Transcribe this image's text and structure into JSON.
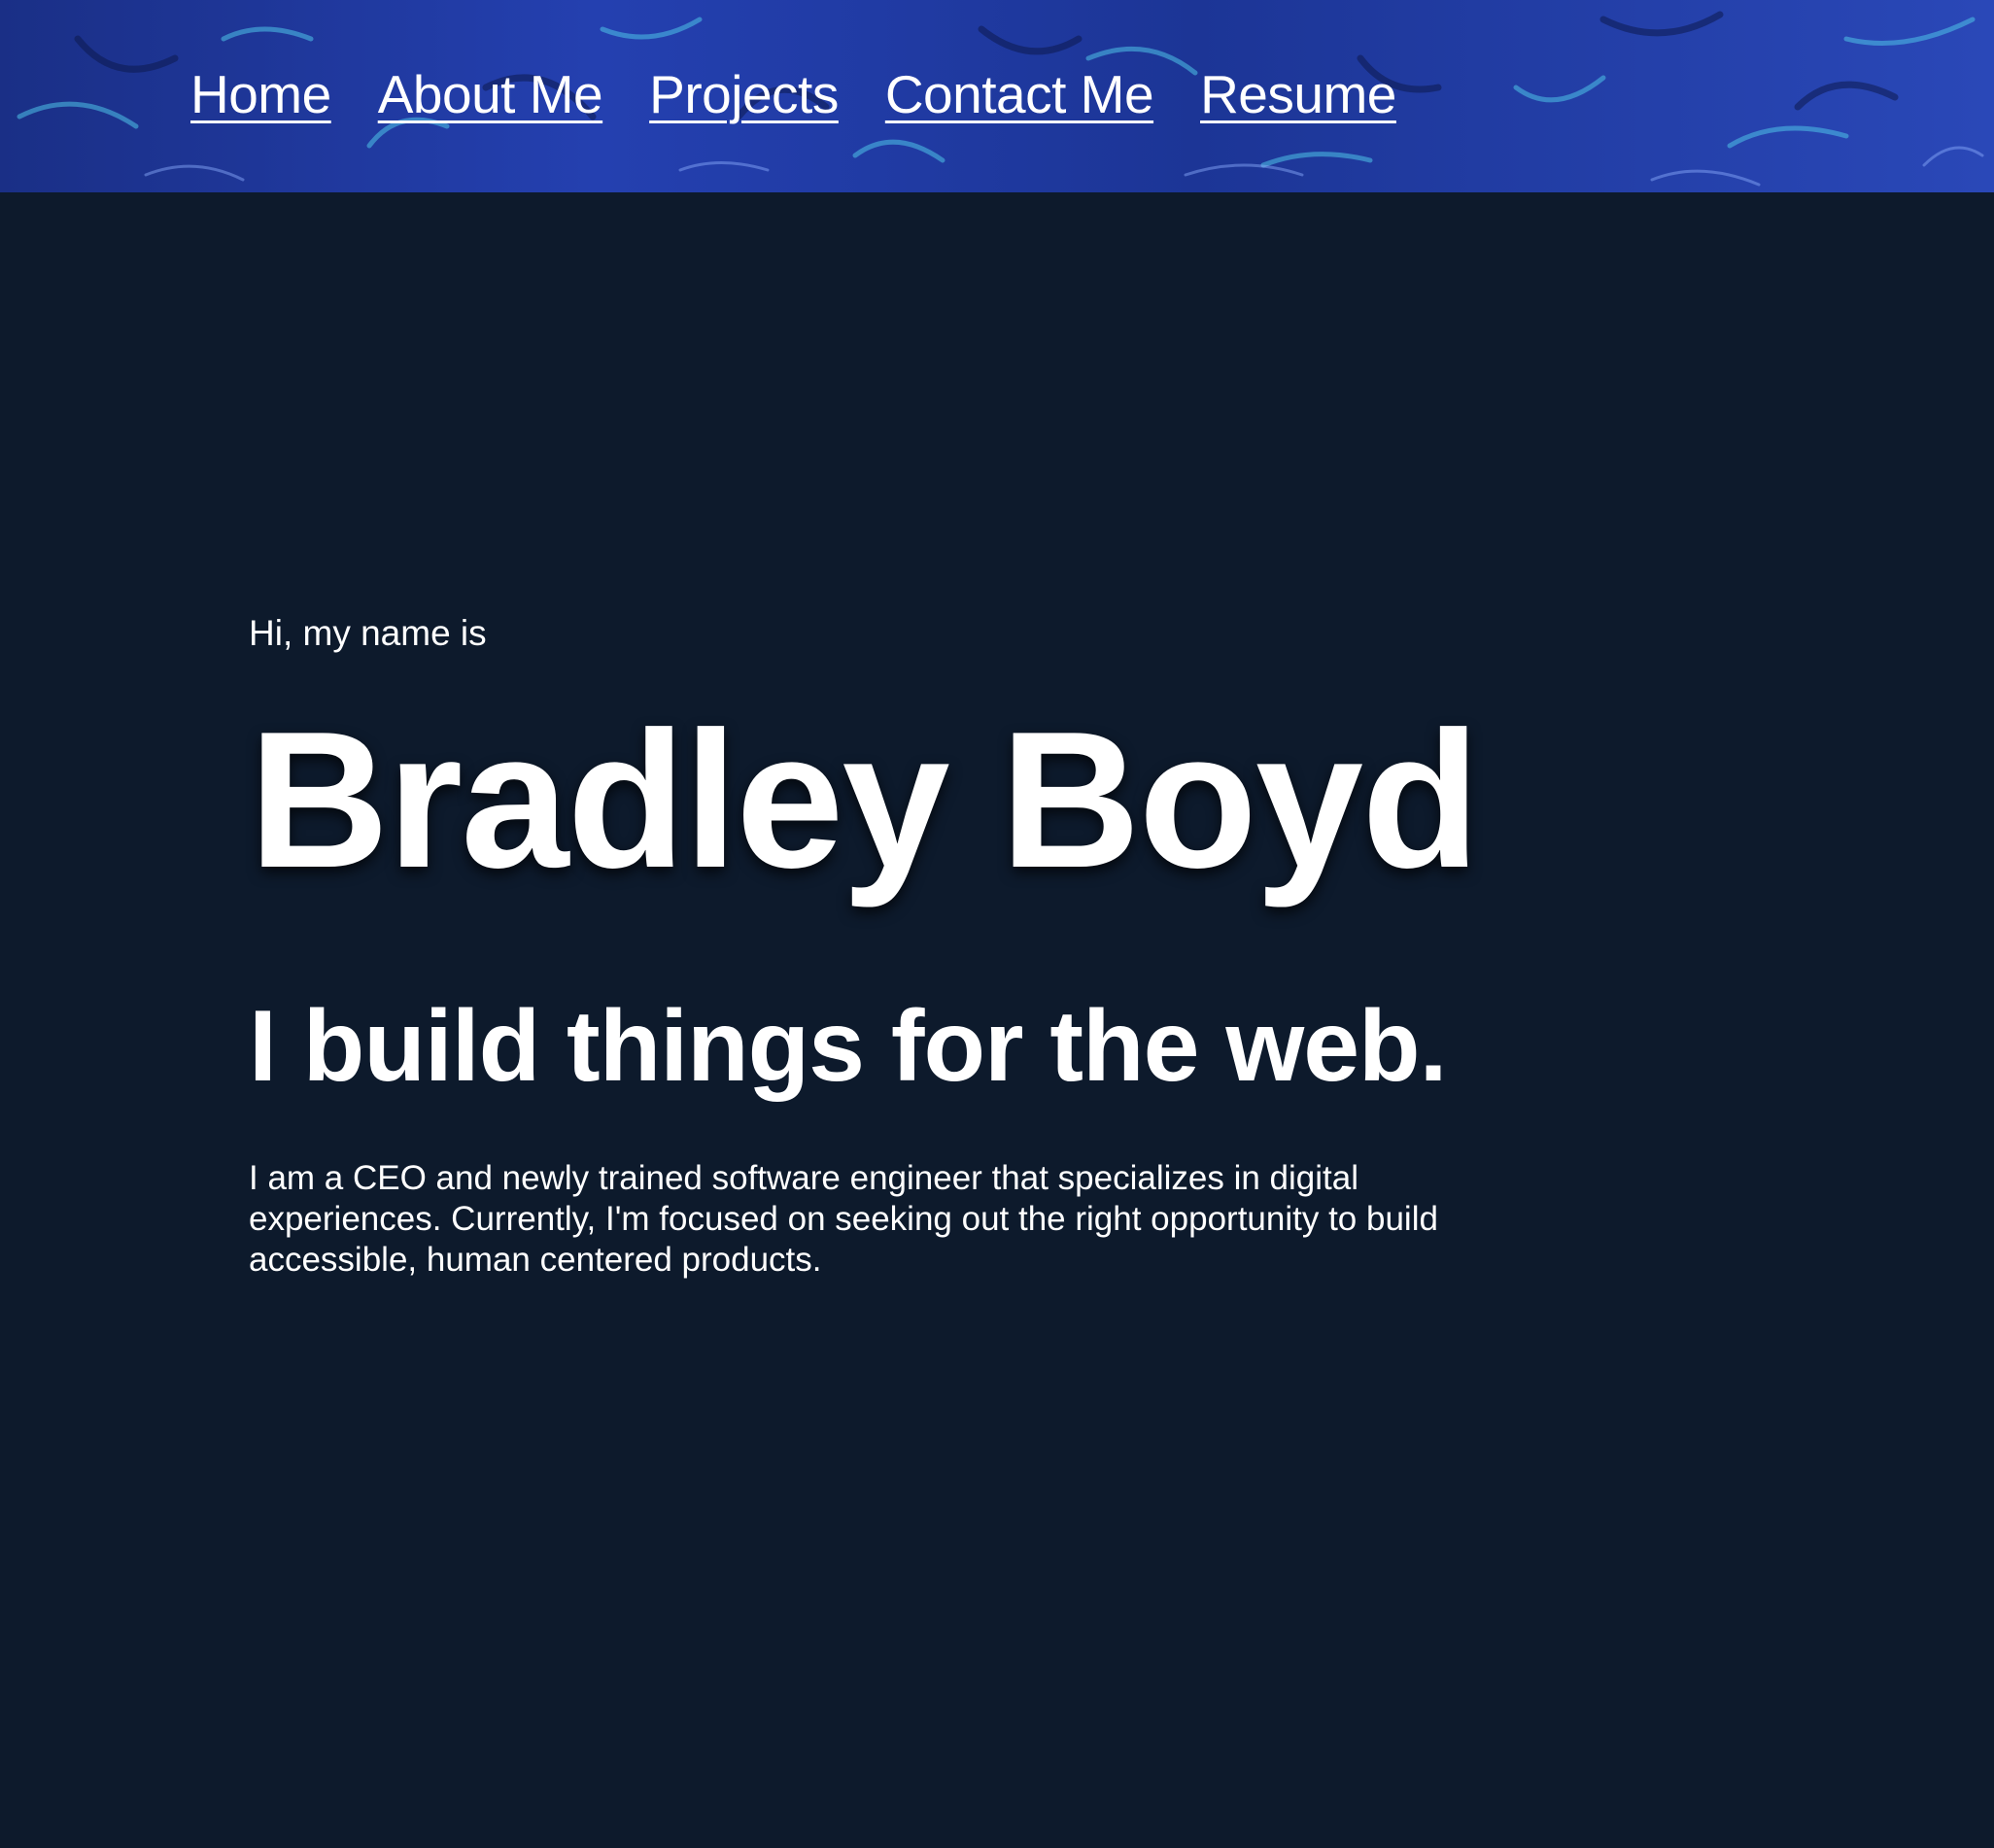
{
  "nav": {
    "items": [
      {
        "label": "Home"
      },
      {
        "label": "About Me"
      },
      {
        "label": "Projects"
      },
      {
        "label": "Contact Me"
      },
      {
        "label": "Resume"
      }
    ]
  },
  "hero": {
    "greeting": "Hi, my name is",
    "name": "Bradley Boyd",
    "tagline": "I build things for the web.",
    "bio": "I am a CEO and newly trained software engineer that specializes in digital experiences. Currently, I'm focused on seeking out the right opportunity to build accessible, human centered products."
  },
  "colors": {
    "background": "#0d1a2c",
    "header_blue": "#1f3a9e",
    "text": "#ffffff"
  }
}
